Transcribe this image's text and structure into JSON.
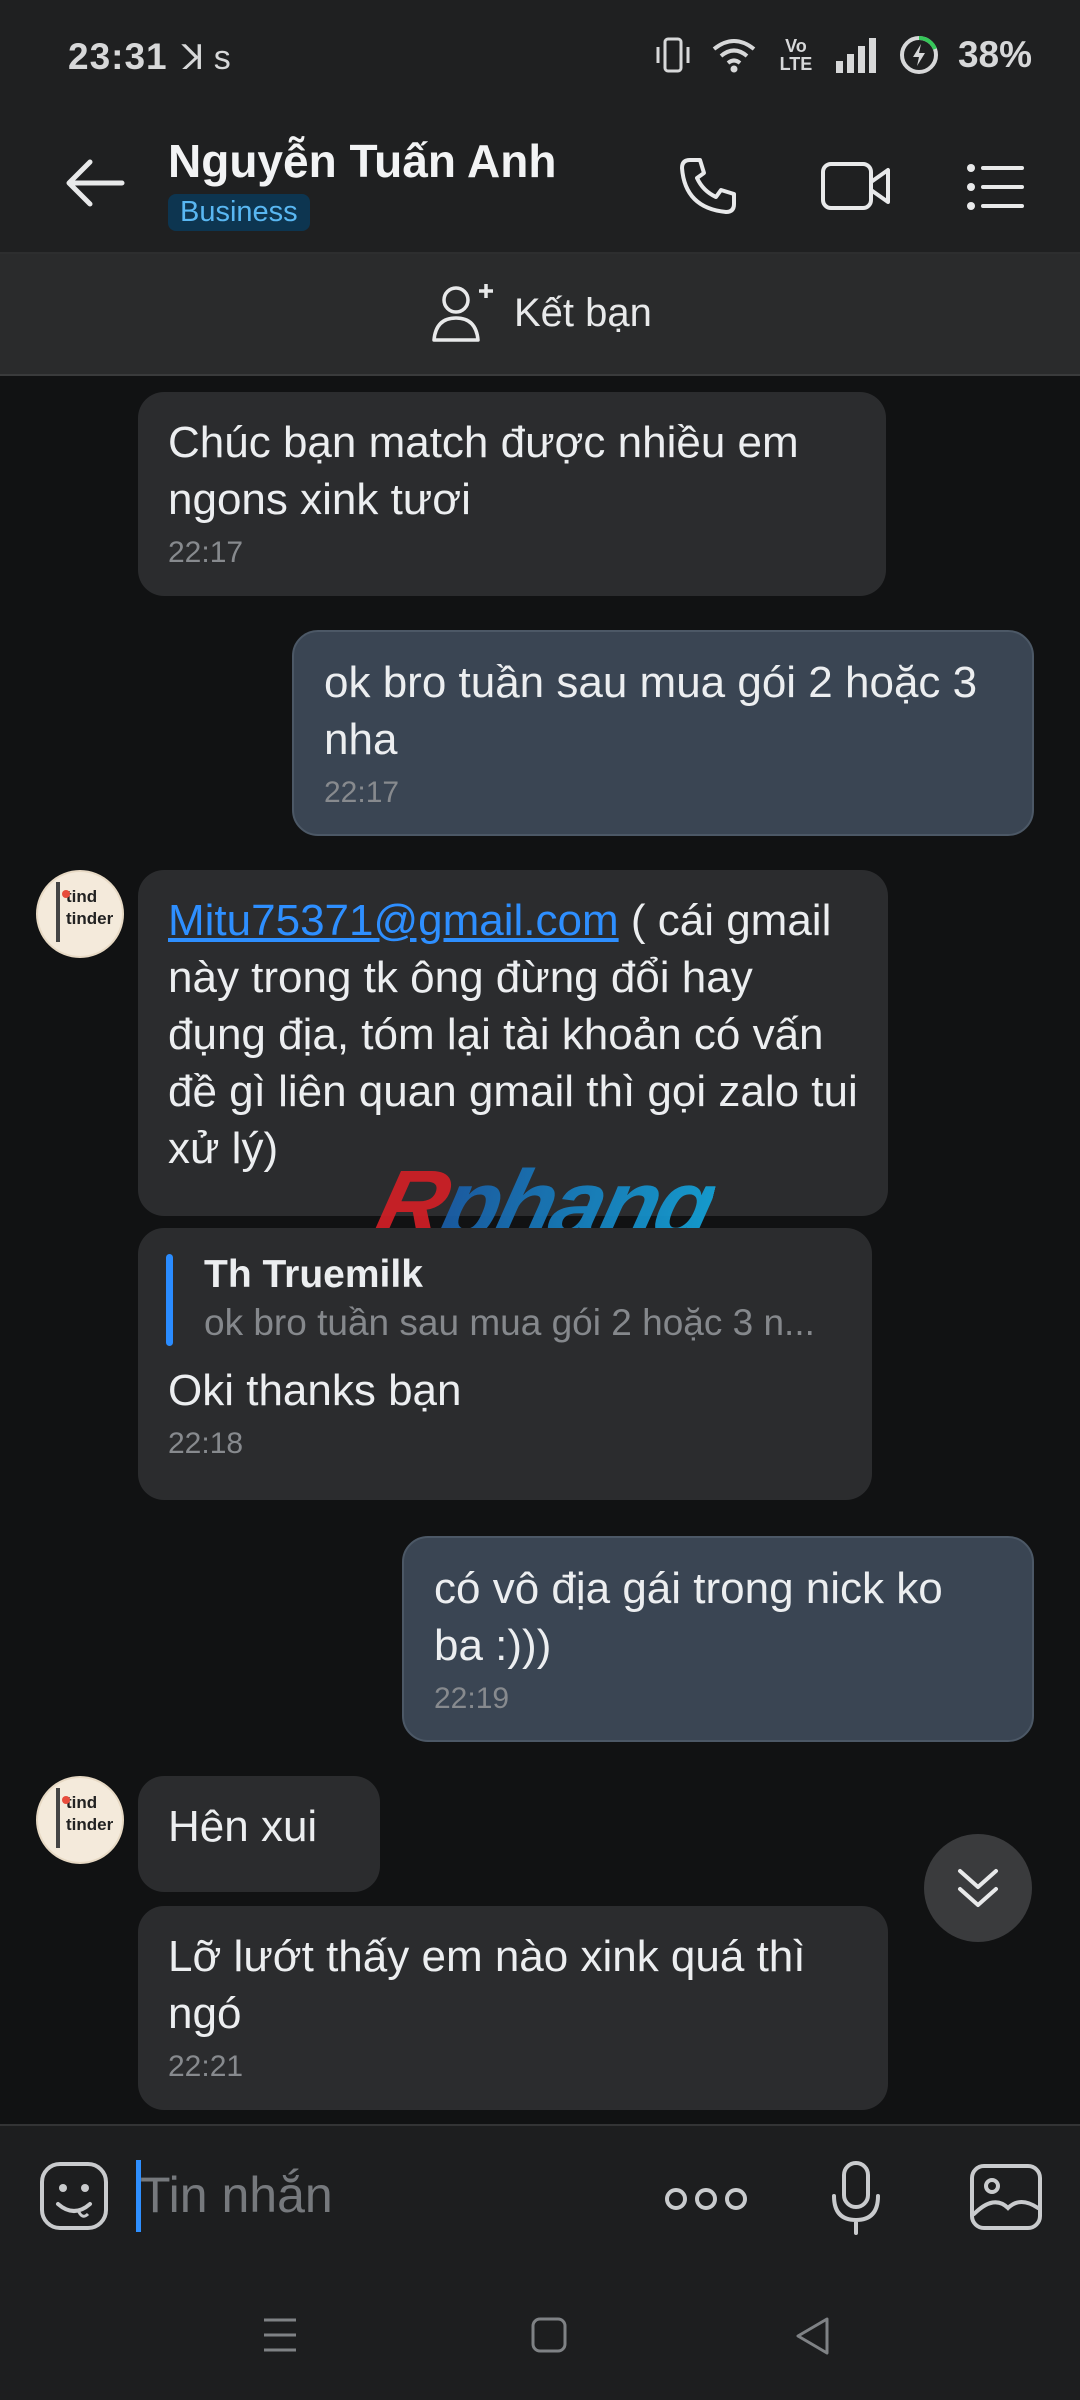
{
  "status_bar": {
    "time": "23:31",
    "battery": "38%",
    "left_icons": "ꓘ s",
    "network": "Vo LTE"
  },
  "header": {
    "contact_name": "Nguyễn Tuấn Anh",
    "badge": "Business"
  },
  "add_friend": {
    "label": "Kết bạn"
  },
  "messages": [
    {
      "direction": "in",
      "text": "Chúc bạn match được nhiều em ngons xink tươi",
      "time": "22:17"
    },
    {
      "direction": "out",
      "text": "ok bro tuần sau mua gói 2 hoặc 3 nha",
      "time": "22:17"
    },
    {
      "direction": "in",
      "link": "Mitu75371@gmail.com",
      "text": " ( cái gmail này trong tk ông đừng đổi hay đụng địa, tóm lại tài khoản có vấn đề gì liên quan gmail thì gọi zalo tui xử lý)"
    },
    {
      "direction": "in",
      "quote_author": "Th Truemilk",
      "quote_text": "ok bro tuần sau mua gói 2 hoặc 3 n...",
      "text": "Oki thanks bạn",
      "time": "22:18"
    },
    {
      "direction": "out",
      "text": "có vô địa gái trong nick ko ba :)))",
      "time": "22:19"
    },
    {
      "direction": "in",
      "text": "Hên xui"
    },
    {
      "direction": "in",
      "text": "Lỡ lướt thấy em nào xink quá thì ngó",
      "time": "22:21"
    }
  ],
  "avatar_text": {
    "line1": "tind",
    "line2": "tinder"
  },
  "watermark": {
    "part1": "R",
    "part2": "phang"
  },
  "input": {
    "placeholder": "Tin nhắn"
  },
  "colors": {
    "accent": "#2e8fff",
    "outgoing_bubble": "#3a4553",
    "incoming_bubble": "#2b2c2e",
    "background": "#111213",
    "badge_bg": "#0d3550"
  }
}
